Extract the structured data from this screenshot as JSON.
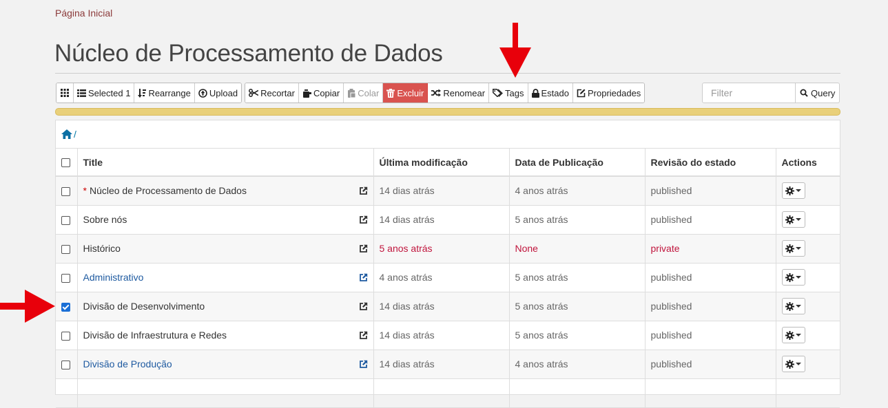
{
  "breadcrumb_top": "Página Inicial",
  "page_title": "Núcleo de Processamento de Dados",
  "toolbar": {
    "group1": [
      {
        "name": "grid-view-button",
        "label": "",
        "icon": "grid-icon"
      },
      {
        "name": "selected-button",
        "label": "Selected 1",
        "icon": "list-icon"
      },
      {
        "name": "rearrange-button",
        "label": "Rearrange",
        "icon": "sort-icon"
      },
      {
        "name": "upload-button",
        "label": "Upload",
        "icon": "upload-icon"
      }
    ],
    "group2": [
      {
        "name": "cut-button",
        "label": "Recortar",
        "icon": "scissors-icon"
      },
      {
        "name": "copy-button",
        "label": "Copiar",
        "icon": "copy-icon"
      },
      {
        "name": "paste-button",
        "label": "Colar",
        "icon": "paste-icon",
        "disabled": true
      },
      {
        "name": "delete-button",
        "label": "Excluir",
        "icon": "trash-icon",
        "danger": true
      },
      {
        "name": "rename-button",
        "label": "Renomear",
        "icon": "shuffle-icon"
      },
      {
        "name": "tags-button",
        "label": "Tags",
        "icon": "tag-icon"
      },
      {
        "name": "state-button",
        "label": "Estado",
        "icon": "lock-icon"
      },
      {
        "name": "properties-button",
        "label": "Propriedades",
        "icon": "edit-icon"
      }
    ]
  },
  "filter": {
    "placeholder": "Filter",
    "value": "",
    "query_label": "Query"
  },
  "path": "/",
  "table": {
    "headers": [
      "Title",
      "Última modificação",
      "Data de Publicação",
      "Revisão do estado",
      "Actions"
    ],
    "rows": [
      {
        "title": "Núcleo de Processamento de Dados",
        "star": "*",
        "modified": "14 dias atrás",
        "published": "4 anos atrás",
        "state": "published",
        "checked": false,
        "style": "normal"
      },
      {
        "title": "Sobre nós",
        "star": "",
        "modified": "14 dias atrás",
        "published": "5 anos atrás",
        "state": "published",
        "checked": false,
        "style": "normal"
      },
      {
        "title": "Histórico",
        "star": "",
        "modified": "5 anos atrás",
        "published": "None",
        "state": "private",
        "checked": false,
        "style": "private"
      },
      {
        "title": "Administrativo",
        "star": "",
        "modified": "4 anos atrás",
        "published": "5 anos atrás",
        "state": "published",
        "checked": false,
        "style": "link"
      },
      {
        "title": "Divisão de Desenvolvimento",
        "star": "",
        "modified": "14 dias atrás",
        "published": "5 anos atrás",
        "state": "published",
        "checked": true,
        "style": "normal"
      },
      {
        "title": "Divisão de Infraestrutura e Redes",
        "star": "",
        "modified": "14 dias atrás",
        "published": "5 anos atrás",
        "state": "published",
        "checked": false,
        "style": "normal"
      },
      {
        "title": "Divisão de Produção",
        "star": "",
        "modified": "14 dias atrás",
        "published": "4 anos atrás",
        "state": "published",
        "checked": false,
        "style": "link"
      },
      {
        "title": "",
        "star": "",
        "modified": "",
        "published": "",
        "state": "",
        "checked": false,
        "style": "normal"
      }
    ]
  },
  "colors": {
    "danger": "#d9534f",
    "status_bar": "#e9d07a",
    "link": "#1e5aa0",
    "private": "#c0143c",
    "annotation_arrow": "#e8000b"
  }
}
